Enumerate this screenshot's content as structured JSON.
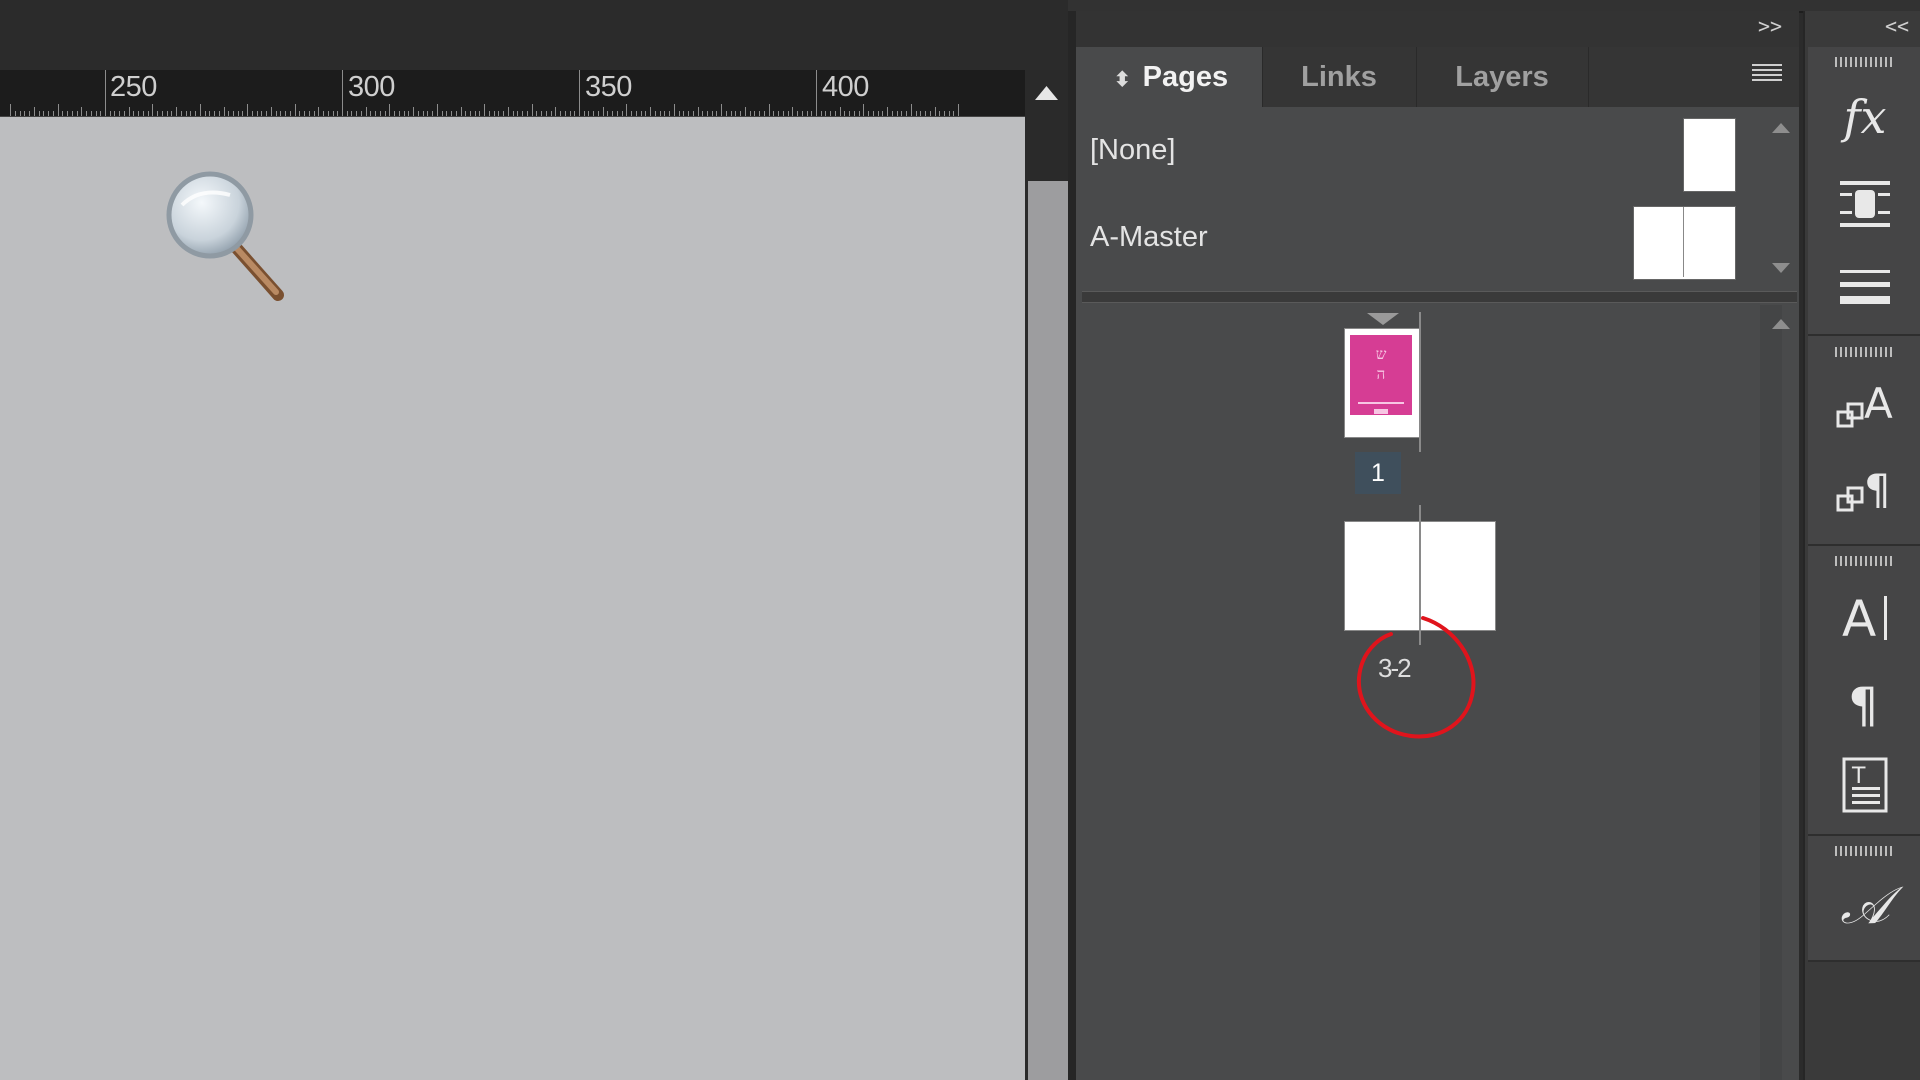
{
  "ruler": {
    "labels": [
      "250",
      "300",
      "350",
      "400"
    ]
  },
  "panel": {
    "tabs": [
      {
        "label": "Pages",
        "active": true
      },
      {
        "label": "Links",
        "active": false
      },
      {
        "label": "Layers",
        "active": false
      }
    ],
    "masters": [
      {
        "label": "[None]"
      },
      {
        "label": "A-Master"
      }
    ],
    "pages": [
      {
        "label": "1"
      },
      {
        "label": "3-2"
      }
    ]
  },
  "dock": {
    "icons": [
      "fx-icon",
      "text-wrap-icon",
      "stroke-icon",
      "character-styles-icon",
      "paragraph-styles-icon",
      "character-icon",
      "paragraph-icon",
      "text-frame-options-icon",
      "glyphs-icon"
    ]
  },
  "colors": {
    "accent": "#d63d94",
    "annotation": "#e0141c"
  }
}
